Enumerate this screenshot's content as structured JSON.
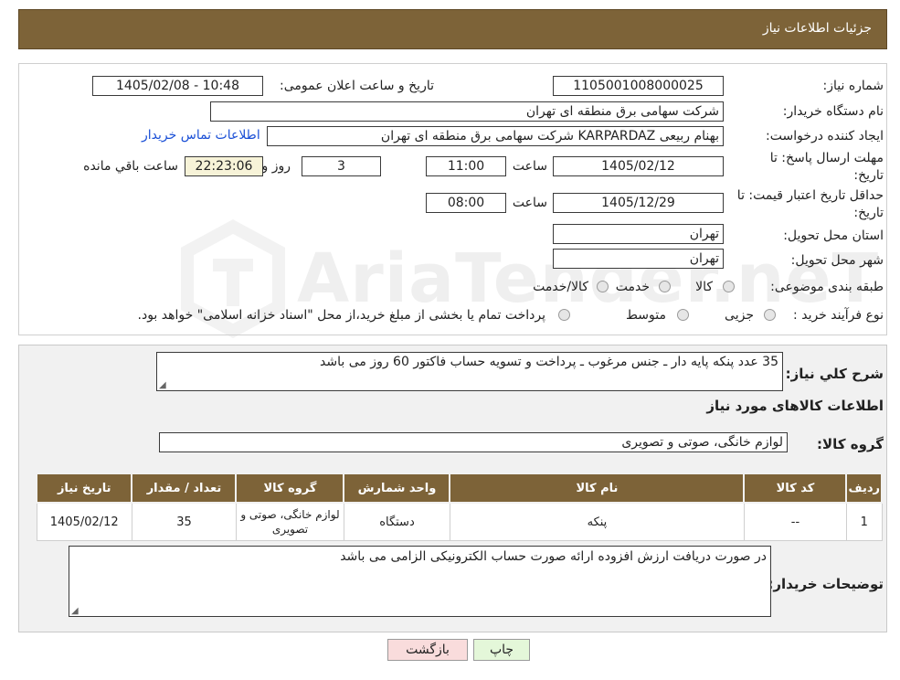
{
  "header": {
    "title": "جزئیات اطلاعات نیاز"
  },
  "form": {
    "need_number_label": "شماره نیاز:",
    "need_number": "1105001008000025",
    "announce_label": "تاریخ و ساعت اعلان عمومی:",
    "announce_value": "1405/02/08 - 10:48",
    "buyer_org_label": "نام دستگاه خریدار:",
    "buyer_org": "شرکت سهامی برق منطقه ای تهران",
    "requester_label": "ایجاد کننده درخواست:",
    "requester": "بهنام ربیعی KARPARDAZ شرکت سهامی برق منطقه ای تهران",
    "contact_link": "اطلاعات تماس خریدار",
    "deadline_label_1": "مهلت ارسال پاسخ: تا",
    "deadline_label_2": "تاریخ:",
    "deadline_date": "1405/02/12",
    "time_label": "ساعت",
    "deadline_time": "11:00",
    "days": "3",
    "days_label": "روز و",
    "remaining_time": "22:23:06",
    "remaining_label": "ساعت باقي مانده",
    "validity_label_1": "حداقل تاریخ اعتبار قیمت: تا",
    "validity_label_2": "تاریخ:",
    "validity_date": "1405/12/29",
    "validity_time": "08:00",
    "province_label": "استان محل تحویل:",
    "province": "تهران",
    "city_label": "شهر محل تحویل:",
    "city": "تهران",
    "category_label": "طبقه بندی موضوعی:",
    "category_options": [
      "کالا",
      "خدمت",
      "کالا/خدمت"
    ],
    "process_label": "نوع فرآیند خرید :",
    "process_options": [
      "جزیی",
      "متوسط"
    ],
    "process_note": "پرداخت تمام یا بخشی از مبلغ خرید،از محل \"اسناد خزانه اسلامی\" خواهد بود."
  },
  "details": {
    "summary_label": "شرح کلي نياز:",
    "summary": "35 عدد پنکه پایه دار ـ جنس مرغوب ـ پرداخت و تسویه حساب فاکتور 60 روز می باشد",
    "goods_info_title": "اطلاعات کالاهای مورد نیاز",
    "goods_group_label": "گروه کالا:",
    "goods_group": "لوازم خانگی، صوتی و تصویری",
    "table": {
      "headers": [
        "ردیف",
        "کد کالا",
        "نام کالا",
        "واحد شمارش",
        "گروه کالا",
        "تعداد / مقدار",
        "تاریخ نیاز"
      ],
      "rows": [
        [
          "1",
          "--",
          "پنکه",
          "دستگاه",
          "لوازم خانگی، صوتی و تصویری",
          "35",
          "1405/02/12"
        ]
      ]
    },
    "buyer_notes_label": "توضیحات خریدار:",
    "buyer_notes": "در صورت دریافت ارزش افزوده ارائه صورت حساب الکترونیکی الزامی می باشد"
  },
  "buttons": {
    "print": "چاپ",
    "back": "بازگشت"
  },
  "watermark": "AriaTender.neT",
  "colors": {
    "header_bg": "#7d6338",
    "link": "#1a4fd6",
    "print_btn": "#e4f7d9",
    "back_btn": "#f9dcdc"
  }
}
